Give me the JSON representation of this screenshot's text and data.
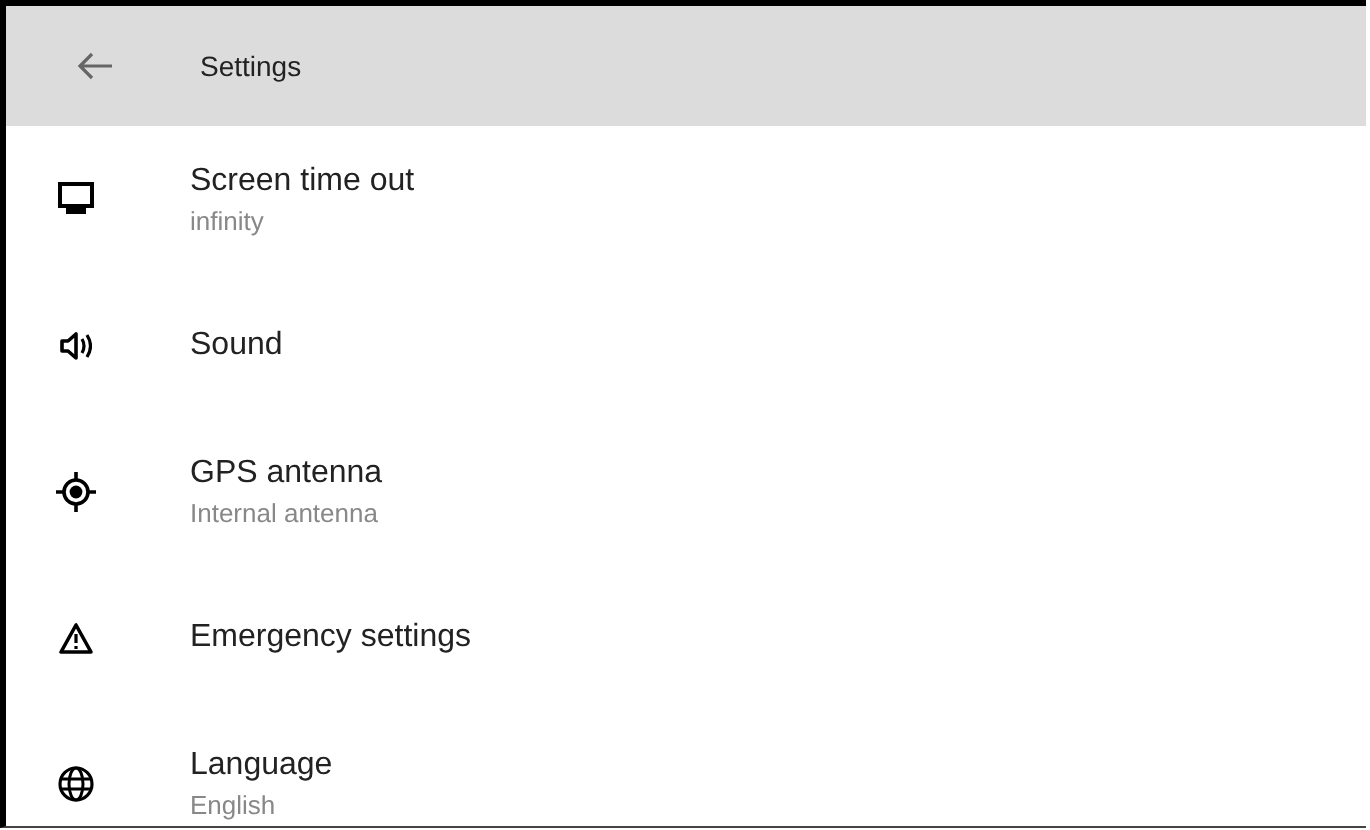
{
  "header": {
    "title": "Settings"
  },
  "items": [
    {
      "title": "Screen time out",
      "subtitle": "infinity"
    },
    {
      "title": "Sound"
    },
    {
      "title": "GPS antenna",
      "subtitle": "Internal antenna"
    },
    {
      "title": "Emergency settings"
    },
    {
      "title": "Language",
      "subtitle": "English"
    }
  ]
}
